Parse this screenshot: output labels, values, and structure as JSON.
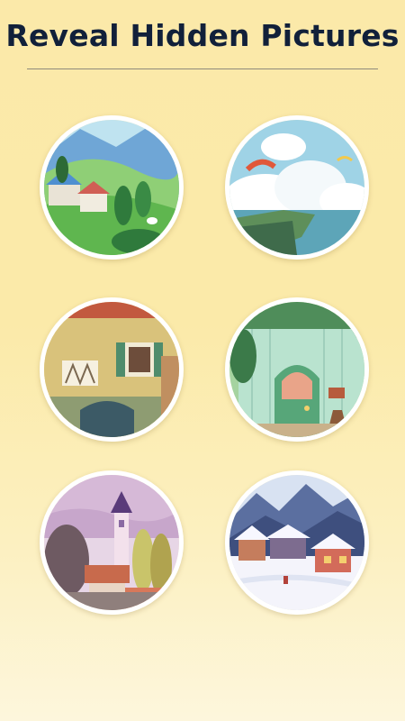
{
  "title": "Reveal Hidden Pictures",
  "pictures": [
    {
      "name": "countryside-hills"
    },
    {
      "name": "seaside-cliff-paragliders"
    },
    {
      "name": "village-house-window"
    },
    {
      "name": "green-door-cottage"
    },
    {
      "name": "lavender-church-town"
    },
    {
      "name": "snowy-village"
    }
  ],
  "colors": {
    "background_top": "#fbe9a9",
    "background_bottom": "#fdf6dc",
    "title": "#11203a",
    "frame": "#ffffff"
  }
}
